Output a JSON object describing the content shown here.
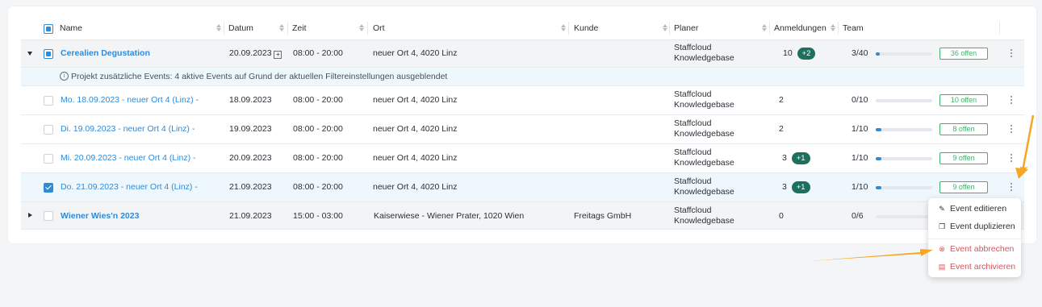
{
  "columns": {
    "name": "Name",
    "datum": "Datum",
    "zeit": "Zeit",
    "ort": "Ort",
    "kunde": "Kunde",
    "planer": "Planer",
    "anmeldungen": "Anmeldungen",
    "team": "Team"
  },
  "info_text": "Projekt zusätzliche Events:  4 aktive Events auf Grund der aktuellen Filtereinstellungen ausgeblendet",
  "rows": [
    {
      "name": "Cerealien Degustation",
      "datum": "20.09.2023",
      "zeit": "08:00 - 20:00",
      "ort": "neuer Ort 4, 4020 Linz",
      "kunde": "",
      "planer_1": "Staffcloud",
      "planer_2": "Knowledgebase",
      "anmeldungen": "10",
      "badge": "+2",
      "team": "3/40",
      "team_fill": 0.075,
      "open": "36 offen"
    },
    {
      "name": "Mo. 18.09.2023 - neuer Ort 4 (Linz) -",
      "datum": "18.09.2023",
      "zeit": "08:00 - 20:00",
      "ort": "neuer Ort 4, 4020 Linz",
      "kunde": "",
      "planer_1": "Staffcloud",
      "planer_2": "Knowledgebase",
      "anmeldungen": "2",
      "badge": "",
      "team": "0/10",
      "team_fill": 0,
      "open": "10 offen"
    },
    {
      "name": "Di. 19.09.2023 - neuer Ort 4 (Linz) -",
      "datum": "19.09.2023",
      "zeit": "08:00 - 20:00",
      "ort": "neuer Ort 4, 4020 Linz",
      "kunde": "",
      "planer_1": "Staffcloud",
      "planer_2": "Knowledgebase",
      "anmeldungen": "2",
      "badge": "",
      "team": "1/10",
      "team_fill": 0.1,
      "open": "8 offen"
    },
    {
      "name": "Mi. 20.09.2023 - neuer Ort 4 (Linz) -",
      "datum": "20.09.2023",
      "zeit": "08:00 - 20:00",
      "ort": "neuer Ort 4, 4020 Linz",
      "kunde": "",
      "planer_1": "Staffcloud",
      "planer_2": "Knowledgebase",
      "anmeldungen": "3",
      "badge": "+1",
      "team": "1/10",
      "team_fill": 0.1,
      "open": "9 offen"
    },
    {
      "name": "Do. 21.09.2023 - neuer Ort 4 (Linz) -",
      "datum": "21.09.2023",
      "zeit": "08:00 - 20:00",
      "ort": "neuer Ort 4, 4020 Linz",
      "kunde": "",
      "planer_1": "Staffcloud",
      "planer_2": "Knowledgebase",
      "anmeldungen": "3",
      "badge": "+1",
      "team": "1/10",
      "team_fill": 0.1,
      "open": "9 offen"
    },
    {
      "name": "Wiener Wies'n 2023",
      "datum": "21.09.2023",
      "zeit": "15:00 - 03:00",
      "ort": "Kaiserwiese - Wiener Prater, 1020 Wien",
      "kunde": "Freitags GmbH",
      "planer_1": "Staffcloud",
      "planer_2": "Knowledgebase",
      "anmeldungen": "0",
      "badge": "",
      "team": "0/6",
      "team_fill": 0,
      "open": ""
    }
  ],
  "menu": {
    "edit": "Event editieren",
    "duplicate": "Event duplizieren",
    "cancel": "Event abbrechen",
    "archive": "Event archivieren"
  },
  "colors": {
    "accent": "#2f8ad8",
    "open_green": "#3fb26b",
    "badge_green": "#1e6f5c",
    "danger": "#e0505a",
    "arrow": "#f5a623"
  }
}
